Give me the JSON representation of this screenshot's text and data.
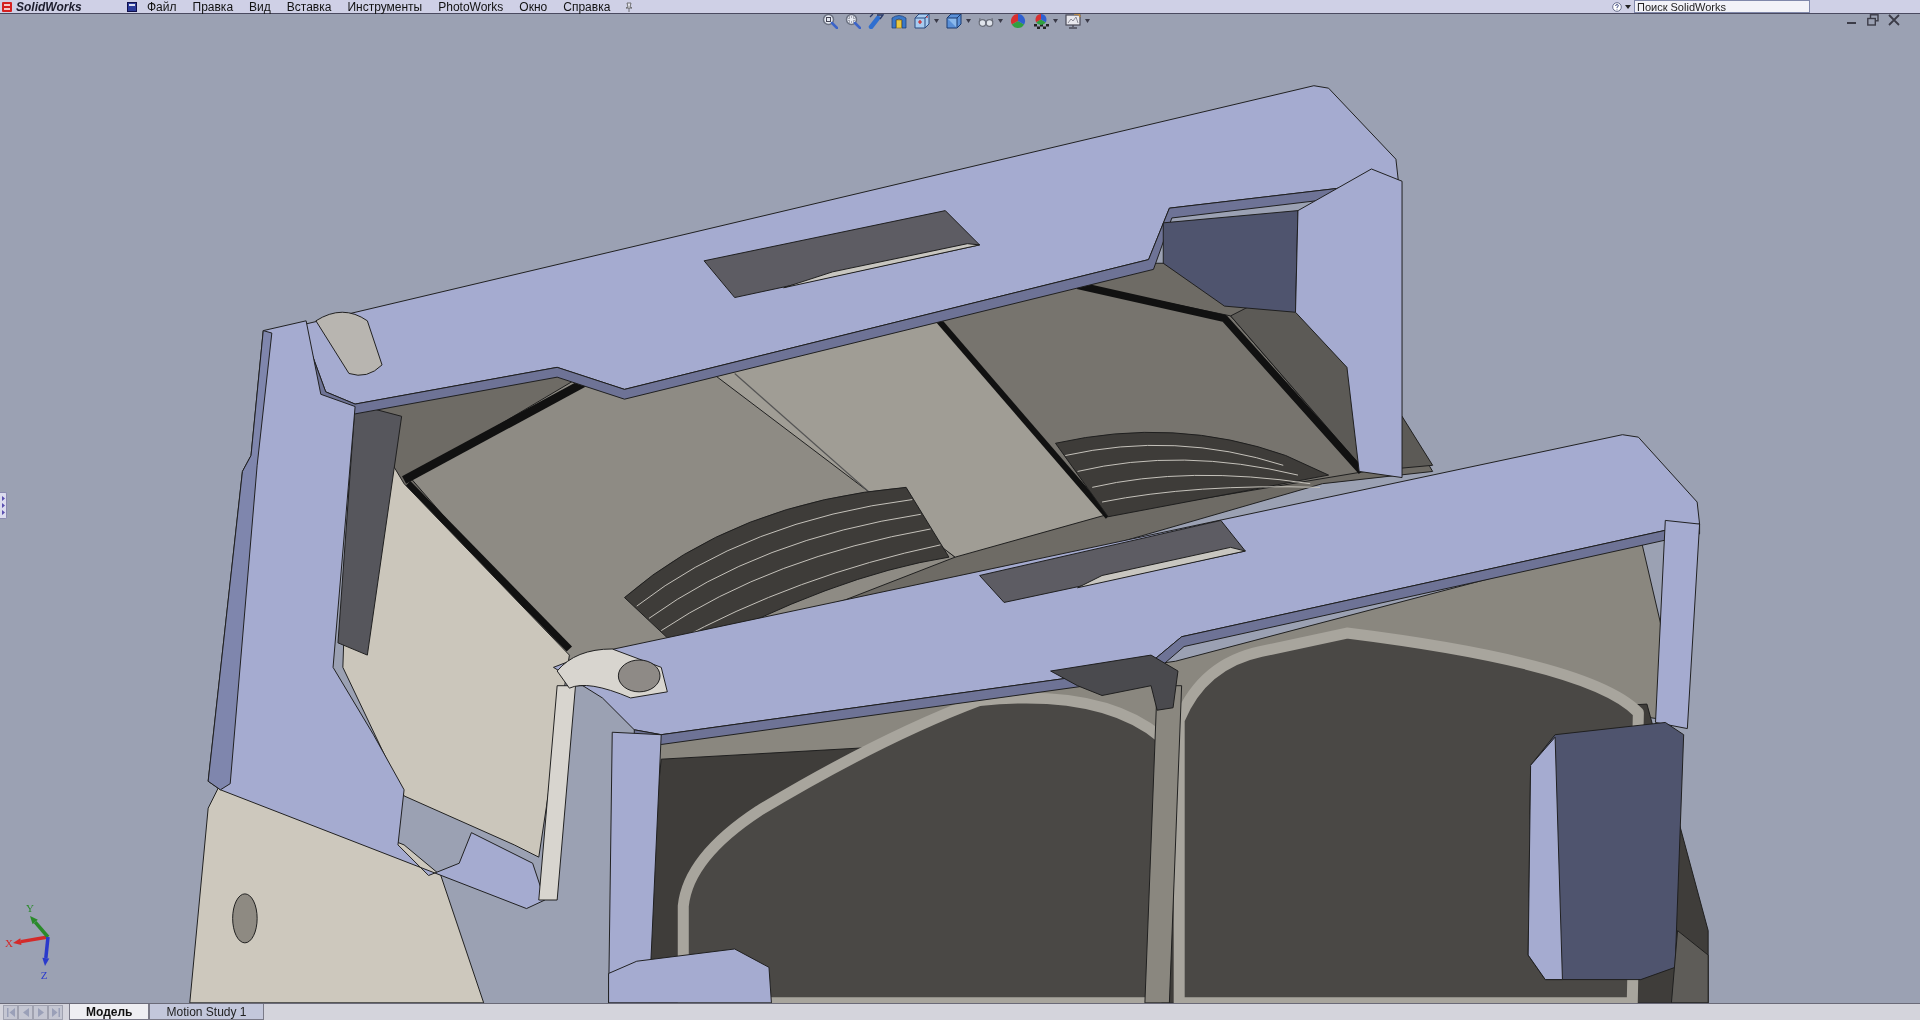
{
  "menu_bar": {
    "logo": "SolidWorks",
    "items": [
      "Файл",
      "Правка",
      "Вид",
      "Вставка",
      "Инструменты",
      "PhotoWorks",
      "Окно",
      "Справка"
    ]
  },
  "search": {
    "placeholder": "Поиск SolidWorks"
  },
  "heads_up_toolbar": [
    {
      "kind": "zoomfit",
      "dropdown": false
    },
    {
      "kind": "zoomarea",
      "dropdown": false
    },
    {
      "kind": "previous",
      "dropdown": false
    },
    {
      "kind": "section",
      "dropdown": false
    },
    {
      "kind": "orientation",
      "dropdown": true
    },
    {
      "kind": "display",
      "dropdown": true
    },
    {
      "kind": "visibility",
      "dropdown": true
    },
    {
      "kind": "appearance",
      "dropdown": false
    },
    {
      "kind": "scene",
      "dropdown": true
    },
    {
      "kind": "settings",
      "dropdown": true
    }
  ],
  "triad": [
    {
      "label": "X",
      "color": "#d42a2a"
    },
    {
      "label": "Y",
      "color": "#2a8a2a"
    },
    {
      "label": "Z",
      "color": "#2a3acc"
    }
  ],
  "model_tabs": [
    {
      "label": "Модель",
      "selected": true
    },
    {
      "label": "Motion Study 1",
      "selected": false
    }
  ]
}
